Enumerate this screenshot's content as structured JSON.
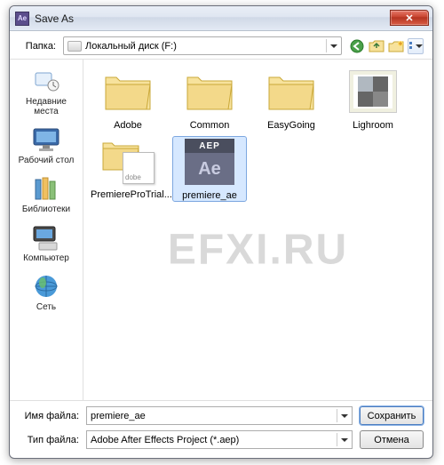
{
  "window": {
    "title": "Save As",
    "close_glyph": "✕"
  },
  "toprow": {
    "folder_label": "Папка:",
    "folder_value": "Локальный диск (F:)"
  },
  "sidebar": {
    "items": [
      {
        "label": "Недавние места"
      },
      {
        "label": "Рабочий стол"
      },
      {
        "label": "Библиотеки"
      },
      {
        "label": "Компьютер"
      },
      {
        "label": "Сеть"
      }
    ]
  },
  "grid": {
    "items": [
      {
        "label": "Adobe",
        "kind": "folder"
      },
      {
        "label": "Common",
        "kind": "folder"
      },
      {
        "label": "EasyGoing",
        "kind": "folder"
      },
      {
        "label": "Lighroom",
        "kind": "lighroom"
      },
      {
        "label": "PremiereProTrial...",
        "kind": "premierepro"
      },
      {
        "label": "premiere_ae",
        "kind": "aep",
        "selected": true,
        "badge_top": "AEP",
        "badge_main": "Ae"
      }
    ]
  },
  "watermark": "EFXI.RU",
  "footer": {
    "filename_label": "Имя файла:",
    "filename_value": "premiere_ae",
    "filetype_label": "Тип файла:",
    "filetype_value": "Adobe After Effects Project (*.aep)",
    "save_label": "Сохранить",
    "cancel_label": "Отмена"
  }
}
